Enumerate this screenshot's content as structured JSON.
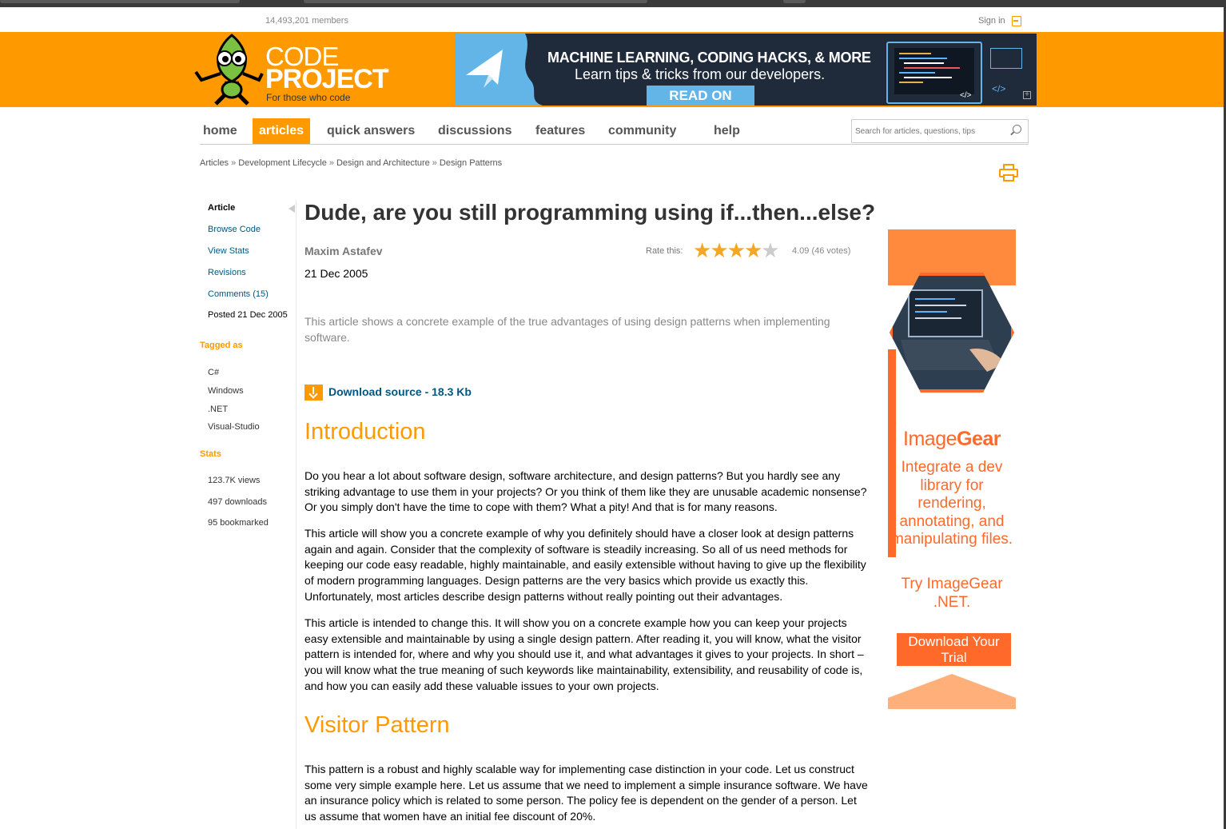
{
  "header": {
    "members": "14,493,201 members",
    "sign_in": "Sign in",
    "logo_line1": "CODE",
    "logo_line2": "PROJECT",
    "logo_reg": "®",
    "logo_tagline": "For those who code",
    "colors": {
      "brand_orange": "#ff9900",
      "link_blue": "#005782"
    }
  },
  "banner": {
    "title": "MACHINE LEARNING, CODING HACKS, & MORE",
    "subtitle": "Learn tips & tricks from our developers.",
    "button": "READ ON",
    "code_glyph": "</>"
  },
  "nav": {
    "items": [
      {
        "label": "home",
        "active": false
      },
      {
        "label": "articles",
        "active": true
      },
      {
        "label": "quick answers",
        "active": false
      },
      {
        "label": "discussions",
        "active": false
      },
      {
        "label": "features",
        "active": false
      },
      {
        "label": "community",
        "active": false
      },
      {
        "label": "help",
        "active": false
      }
    ],
    "search_placeholder": "Search for articles, questions, tips"
  },
  "breadcrumb": [
    "Articles",
    "Development Lifecycle",
    "Design and Architecture",
    "Design Patterns"
  ],
  "breadcrumb_sep": "»",
  "sidebar": {
    "links": [
      "Article",
      "Browse Code",
      "View Stats",
      "Revisions",
      "Comments (15)"
    ],
    "posted": "Posted 21 Dec 2005",
    "tagged_heading": "Tagged as",
    "tags": [
      "C#",
      "Windows",
      ".NET",
      "Visual-Studio"
    ],
    "stats_heading": "Stats",
    "stats": [
      "123.7K views",
      "497 downloads",
      "95 bookmarked"
    ]
  },
  "article": {
    "title": "Dude, are you still programming using if...then...else?",
    "author": "Maxim Astafev",
    "date": "21 Dec 2005",
    "rate_label": "Rate this:",
    "rating": 4.09,
    "rating_text": "4.09 (46 votes)",
    "summary": "This article shows a concrete example of the true advantages of using design patterns when implementing software.",
    "download": "Download source - 18.3 Kb",
    "h_intro": "Introduction",
    "p1": "Do you hear a lot about software design, software architecture, and design patterns? But you hardly see any striking advantage to use them in your projects? Or you think of them like they are unusable academic nonsense? Or you simply don't have the time to cope with them? What a pity! And that is for many reasons.",
    "p2": "This article will show you a concrete example of why you definitely should have a closer look at design patterns again and again. Consider that the complexity of software is steadily increasing. So all of us need methods for keeping our code easy readable, highly maintainable, and easily extensible without having to give up the flexibility of modern programming languages. Design patterns are the very basics which provide us exactly this. Unfortunately, most articles describe design patterns without really pointing out their advantages.",
    "p3": "This article is intended to change this. It will show you on a concrete example how you can keep your projects easy extensible and maintainable by using a single design pattern. After reading it, you will know, what the visitor pattern is intended for, where and why you should use it, and what advantages it gives to your projects. In short – you will know what the true meaning of such keywords like maintainability, extensibility, and reusability of code is, and how you can easily add these valuable issues to your own projects.",
    "h_visitor": "Visitor Pattern",
    "p4": "This pattern is a robust and highly scalable way for implementing case distinction in your code. Let us construct some very simple example here. Let us assume that we need to implement a simple insurance software. We have an insurance policy which is related to some person. The policy fee is dependent on the gender of a person. Let us assume that women have an initial fee discount of 20%."
  },
  "ad": {
    "brand_light": "Image",
    "brand_bold": "Gear",
    "text": "Integrate a dev library for rendering, annotating, and manipulating files.",
    "try": "Try ImageGear .NET.",
    "button": "Download Your Trial"
  }
}
